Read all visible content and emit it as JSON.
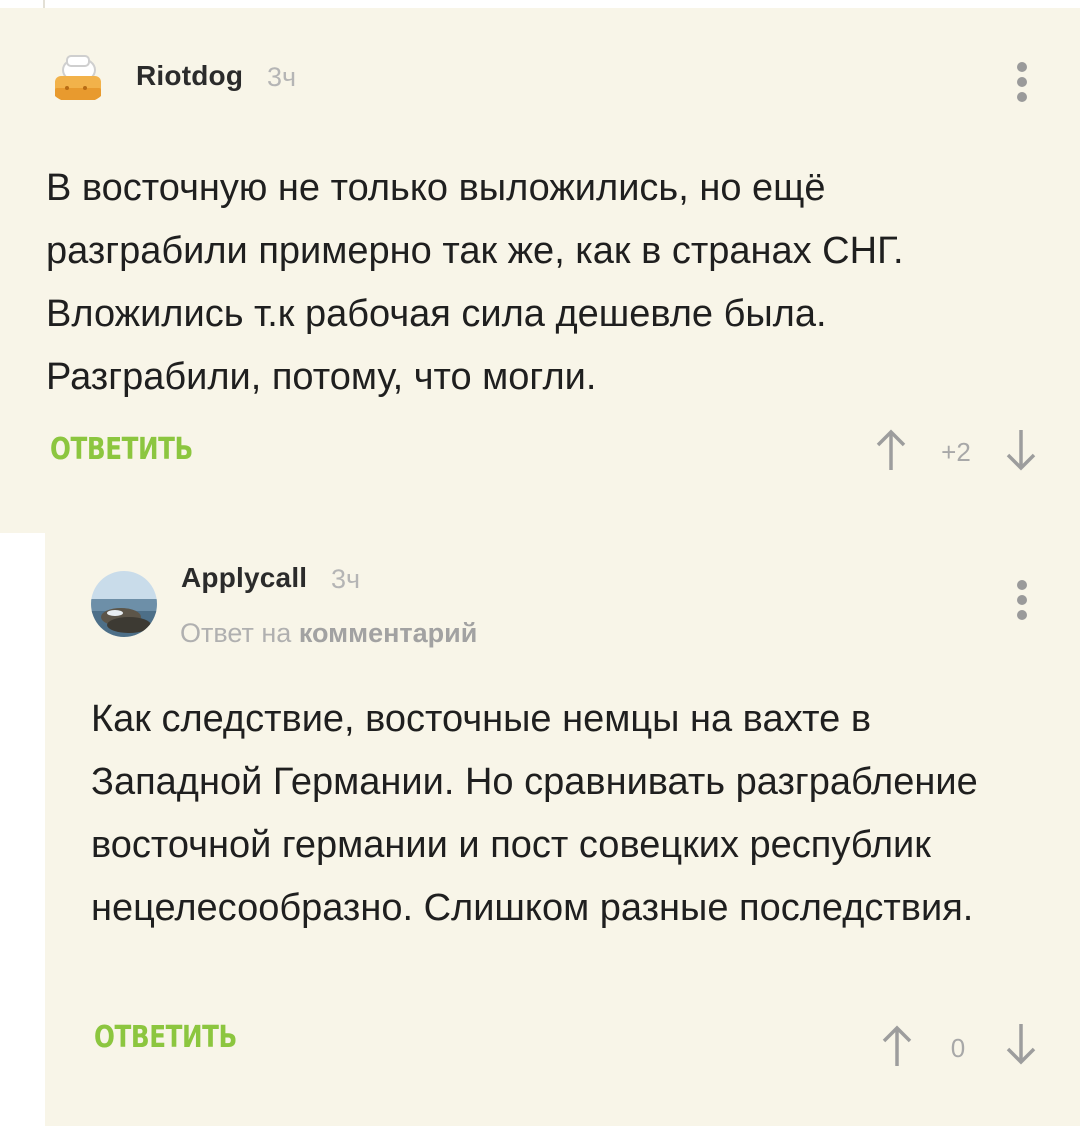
{
  "comments": [
    {
      "author": "Riotdog",
      "time": "3ч",
      "text": "В восточную не только выложились, но ещё разграбили примерно так же, как в странах СНГ. Вложились т.к рабочая сила дешевле была. Разграбили, потому, что могли.",
      "reply_label": "ОТВЕТИТЬ",
      "rating": "+2"
    },
    {
      "author": "Applycall",
      "time": "3ч",
      "reply_to_prefix": "Ответ на",
      "reply_to_link": "комментарий",
      "text": "Как следствие, восточные немцы на вахте в Западной Германии. Но сравнивать разграбление восточной германии и пост совецких республик нецелесообразно. Слишком разные последствия.",
      "reply_label": "ОТВЕТИТЬ",
      "rating": "0"
    }
  ],
  "colors": {
    "comment_bg": "#f8f5e8",
    "reply_green": "#8cc63f",
    "muted": "#b5b5b5"
  },
  "icons": [
    "kebab-menu-icon",
    "upvote-arrow-icon",
    "downvote-arrow-icon"
  ]
}
